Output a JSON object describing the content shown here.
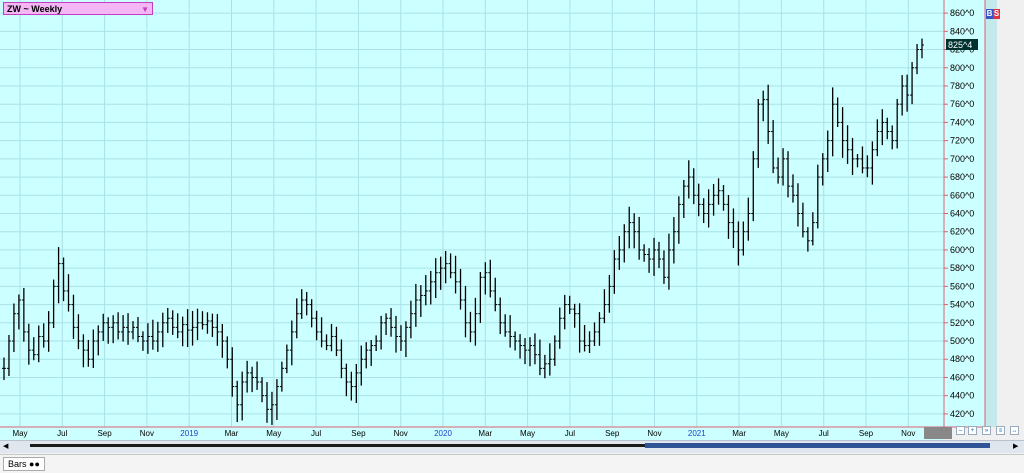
{
  "symbol": {
    "label": "ZW ~ Weekly"
  },
  "buttons": {
    "b": "B",
    "s": "S"
  },
  "bottom": {
    "tab_label": "Bars"
  },
  "colors": {
    "background": "#ccffff",
    "grid": "#a8e2e8",
    "bars": "#000000",
    "axis_line": "#e06070",
    "price_box": "#003330"
  },
  "chart_data": {
    "type": "ohlc_bar",
    "interval": "weekly",
    "title": "",
    "last_price_label": "825^4",
    "ylim": [
      410,
      870
    ],
    "y_ticks": [
      420,
      440,
      460,
      480,
      500,
      520,
      540,
      560,
      580,
      600,
      620,
      640,
      660,
      680,
      700,
      720,
      740,
      760,
      780,
      800,
      820,
      840,
      860
    ],
    "y_tick_labels": [
      "420^0",
      "440^0",
      "460^0",
      "480^0",
      "500^0",
      "520^0",
      "540^0",
      "560^0",
      "580^0",
      "600^0",
      "620^0",
      "640^0",
      "660^0",
      "680^0",
      "700^0",
      "720^0",
      "740^0",
      "760^0",
      "780^0",
      "800^0",
      "820^0",
      "840^0",
      "860^0"
    ],
    "x_ticks": [
      {
        "label": "May",
        "year": false
      },
      {
        "label": "Jul",
        "year": false
      },
      {
        "label": "Sep",
        "year": false
      },
      {
        "label": "Nov",
        "year": false
      },
      {
        "label": "2019",
        "year": true
      },
      {
        "label": "Mar",
        "year": false
      },
      {
        "label": "May",
        "year": false
      },
      {
        "label": "Jul",
        "year": false
      },
      {
        "label": "Sep",
        "year": false
      },
      {
        "label": "Nov",
        "year": false
      },
      {
        "label": "2020",
        "year": true
      },
      {
        "label": "Mar",
        "year": false
      },
      {
        "label": "May",
        "year": false
      },
      {
        "label": "Jul",
        "year": false
      },
      {
        "label": "Sep",
        "year": false
      },
      {
        "label": "Nov",
        "year": false
      },
      {
        "label": "2021",
        "year": true
      },
      {
        "label": "Mar",
        "year": false
      },
      {
        "label": "May",
        "year": false
      },
      {
        "label": "Jul",
        "year": false
      },
      {
        "label": "Sep",
        "year": false
      },
      {
        "label": "Nov",
        "year": false
      }
    ],
    "grid": true,
    "close_path": [
      470,
      500,
      530,
      545,
      510,
      490,
      485,
      505,
      500,
      520,
      560,
      585,
      555,
      540,
      515,
      500,
      490,
      480,
      500,
      510,
      520,
      515,
      520,
      510,
      515,
      510,
      515,
      505,
      500,
      505,
      500,
      510,
      520,
      525,
      515,
      510,
      518,
      512,
      515,
      520,
      518,
      522,
      515,
      510,
      500,
      480,
      450,
      430,
      455,
      465,
      460,
      455,
      440,
      425,
      430,
      450,
      470,
      490,
      510,
      530,
      545,
      540,
      525,
      510,
      500,
      495,
      505,
      490,
      470,
      455,
      450,
      465,
      480,
      490,
      495,
      500,
      520,
      525,
      515,
      505,
      500,
      515,
      530,
      545,
      550,
      555,
      565,
      575,
      580,
      585,
      575,
      565,
      545,
      520,
      510,
      530,
      570,
      575,
      555,
      540,
      520,
      510,
      505,
      500,
      495,
      490,
      495,
      485,
      470,
      475,
      480,
      500,
      525,
      540,
      535,
      530,
      500,
      495,
      500,
      510,
      525,
      540,
      560,
      590,
      600,
      620,
      630,
      620,
      600,
      595,
      590,
      600,
      590,
      570,
      600,
      620,
      650,
      670,
      680,
      660,
      650,
      640,
      650,
      660,
      665,
      650,
      630,
      620,
      600,
      620,
      640,
      700,
      760,
      765,
      730,
      690,
      680,
      700,
      670,
      660,
      640,
      620,
      610,
      630,
      680,
      700,
      720,
      760,
      740,
      720,
      710,
      700,
      700,
      690,
      690,
      710,
      730,
      740,
      730,
      720,
      760,
      780,
      770,
      800,
      820,
      825
    ]
  }
}
